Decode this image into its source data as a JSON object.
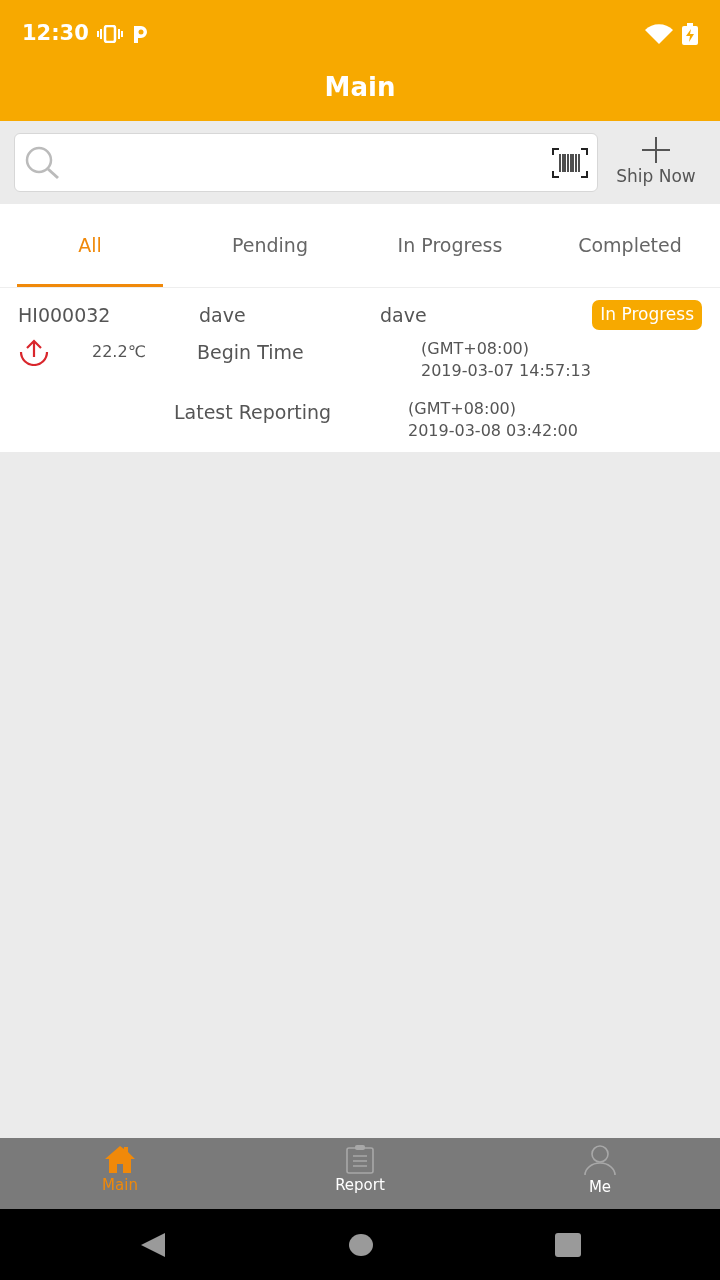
{
  "status_bar": {
    "time": "12:30"
  },
  "header": {
    "title": "Main"
  },
  "search": {
    "action": "Ship Now"
  },
  "tabs": [
    {
      "label": "All",
      "selected": true
    },
    {
      "label": "Pending",
      "selected": false
    },
    {
      "label": "In Progress",
      "selected": false
    },
    {
      "label": "Completed",
      "selected": false
    }
  ],
  "shipments": [
    {
      "id": "HI000032",
      "column_2": "dave",
      "column_3": "dave",
      "status": "In Progress",
      "temperature": "22.2℃",
      "begin_label": "Begin Time",
      "begin_zone": "(GMT+08:00)",
      "begin_time": "2019-03-07 14:57:13",
      "latest_label": "Latest Reporting",
      "latest_zone": "(GMT+08:00)",
      "latest_time": "2019-03-08 03:42:00"
    }
  ],
  "bottom_nav": [
    {
      "label": "Main",
      "kind": "home",
      "selected": true
    },
    {
      "label": "Report",
      "kind": "report",
      "selected": false
    },
    {
      "label": "Me",
      "kind": "profile",
      "selected": false
    }
  ]
}
